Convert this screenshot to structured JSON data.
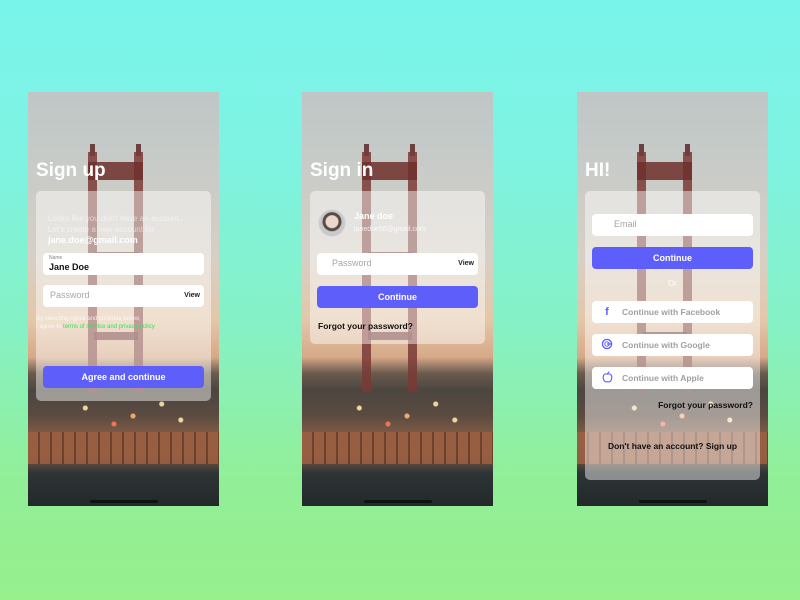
{
  "colors": {
    "accent": "#5e5efb",
    "link_green": "#2ee85a",
    "bg_top": "#79f4ea",
    "bg_bottom": "#97ef8c"
  },
  "signup": {
    "title": "Sign up",
    "intro_line1": "Looks like you don't have an account.",
    "intro_line2": "Let's create a new account for",
    "email": "jane.doe@gmail.com",
    "name_label": "Name",
    "name_value": "Jane Doe",
    "password_placeholder": "Password",
    "view_label": "View",
    "terms_line1": "By selecting Agree and continue below,",
    "terms_prefix": "I agree to ",
    "terms_link": "terms of service and privacy policy",
    "agree_button": "Agree and continue"
  },
  "signin": {
    "title": "Sign in",
    "user_name": "Jane doe",
    "user_email": "janedoe56@gmail.com",
    "avatar_icon": "user-avatar",
    "password_placeholder": "Password",
    "view_label": "View",
    "continue_button": "Continue",
    "forgot_password": "Forgot your password?"
  },
  "hi": {
    "title": "HI!",
    "email_placeholder": "Email",
    "continue_button": "Continue",
    "or_label": "Or",
    "socials": [
      {
        "icon": "facebook-icon",
        "glyph": "f",
        "label": "Continue with Facebook"
      },
      {
        "icon": "google-icon",
        "glyph": "G",
        "label": "Continue with Google"
      },
      {
        "icon": "apple-icon",
        "glyph": "",
        "label": "Continue with Apple"
      }
    ],
    "forgot_password": "Forgot your password?",
    "no_account": "Don't have an account? Sign up"
  }
}
